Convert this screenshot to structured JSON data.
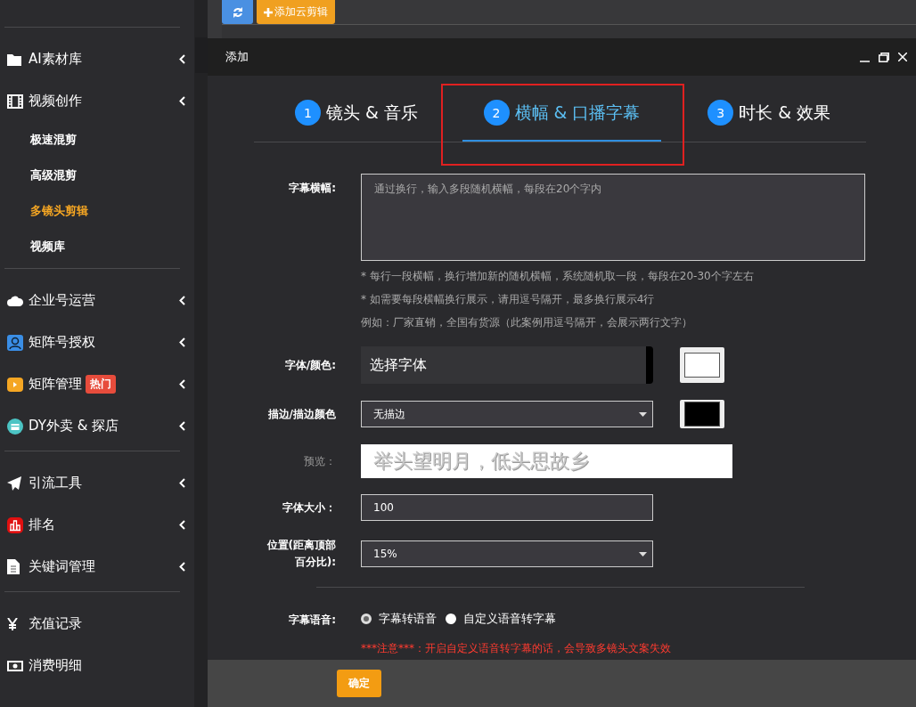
{
  "sidebar": {
    "sections": [
      {
        "items": [
          {
            "label": "AI素材库",
            "expandable": true
          },
          {
            "label": "视频创作",
            "expandable": true,
            "children": [
              {
                "label": "极速混剪",
                "selected": false
              },
              {
                "label": "高级混剪",
                "selected": false
              },
              {
                "label": "多镜头剪辑",
                "selected": true
              },
              {
                "label": "视频库",
                "selected": false
              }
            ]
          }
        ]
      },
      {
        "items": [
          {
            "label": "企业号运营",
            "expandable": true
          },
          {
            "label": "矩阵号授权",
            "expandable": true
          },
          {
            "label": "矩阵管理",
            "expandable": true,
            "badge": "热门"
          },
          {
            "label": "DY外卖 & 探店",
            "expandable": true
          }
        ]
      },
      {
        "items": [
          {
            "label": "引流工具",
            "expandable": true
          },
          {
            "label": "排名",
            "expandable": true
          },
          {
            "label": "关键词管理",
            "expandable": true
          }
        ]
      },
      {
        "items": [
          {
            "label": "充值记录",
            "expandable": false
          },
          {
            "label": "消费明细",
            "expandable": false
          }
        ]
      }
    ]
  },
  "toolbar": {
    "add_button": "添加云剪辑"
  },
  "dialog": {
    "title": "添加",
    "steps": [
      {
        "number": "1",
        "label": "镜头 & 音乐",
        "selected": false,
        "highlighted": false
      },
      {
        "number": "2",
        "label": "横幅 & 口播字幕",
        "selected": true,
        "highlighted": true
      },
      {
        "number": "3",
        "label": "时长 & 效果",
        "selected": false,
        "highlighted": false
      }
    ],
    "rows": [
      {
        "kind": "textarea",
        "label": "字幕横幅:",
        "placeholder": "通过换行，输入多段随机横幅，每段在20个字内",
        "hints": [
          "* 每行一段横幅，换行增加新的随机横幅，系统随机取一段，每段在20-30个字左右",
          "* 如需要每段横幅换行展示，请用逗号隔开，最多换行展示4行",
          "例如：厂家直销，全国有货源（此案例用逗号隔开，会展示两行文字）"
        ]
      },
      {
        "kind": "font",
        "label": "字体/颜色:",
        "value": "选择字体",
        "color": "#ffffff"
      },
      {
        "kind": "select",
        "label": "描边/描边颜色",
        "value": "无描边",
        "color": "#000000"
      },
      {
        "kind": "preview",
        "label": "预览：",
        "text": "举头望明月，低头思故乡"
      },
      {
        "kind": "input",
        "label": "字体大小：",
        "value": "100"
      },
      {
        "kind": "select",
        "label": "位置(距离顶部百分比):",
        "value": "15%"
      }
    ],
    "voice": {
      "label": "字幕语音:",
      "options": [
        {
          "label": "字幕转语音",
          "selected": true
        },
        {
          "label": "自定义语音转字幕",
          "selected": false
        }
      ],
      "warning": "***注意***：开启自定义语音转字幕的话，会导致多镜头文案失效"
    },
    "confirm": "确定"
  }
}
